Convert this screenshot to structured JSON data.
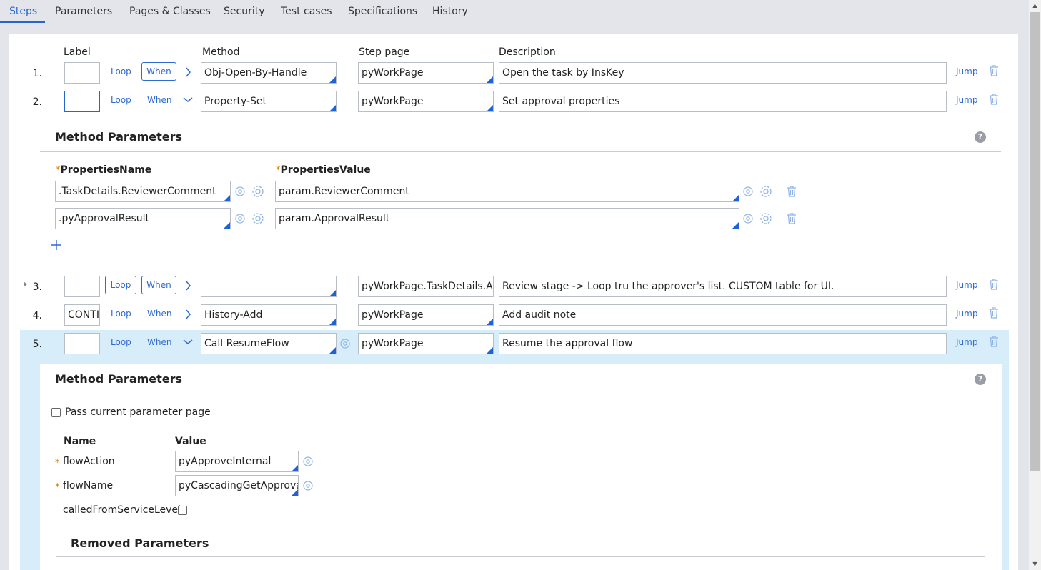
{
  "tabs": [
    "Steps",
    "Parameters",
    "Pages & Classes",
    "Security",
    "Test cases",
    "Specifications",
    "History"
  ],
  "columns": {
    "label": "Label",
    "method": "Method",
    "step_page": "Step page",
    "description": "Description"
  },
  "steps": [
    {
      "num": "1.",
      "label": "",
      "loop": "Loop",
      "when": "When",
      "method": "Obj-Open-By-Handle",
      "step_page": "pyWorkPage",
      "description": "Open the task by InsKey",
      "jump": "Jump"
    },
    {
      "num": "2.",
      "label": "",
      "loop": "Loop",
      "when": "When",
      "method": "Property-Set",
      "step_page": "pyWorkPage",
      "description": "Set approval properties",
      "jump": "Jump"
    },
    {
      "num": "3.",
      "label": "",
      "loop": "Loop",
      "when": "When",
      "method": "",
      "step_page": "pyWorkPage.TaskDetails.Ap",
      "description": "Review stage -> Loop tru the approver's list. CUSTOM table for UI.",
      "jump": "Jump"
    },
    {
      "num": "4.",
      "label": "CONTI",
      "loop": "Loop",
      "when": "When",
      "method": "History-Add",
      "step_page": "pyWorkPage",
      "description": "Add audit note",
      "jump": "Jump"
    },
    {
      "num": "5.",
      "label": "",
      "loop": "Loop",
      "when": "When",
      "method": "Call ResumeFlow",
      "step_page": "pyWorkPage",
      "description": "Resume the approval flow",
      "jump": "Jump"
    }
  ],
  "method_params_1": {
    "title": "Method Parameters",
    "help": "?",
    "name_header": "PropertiesName",
    "value_header": "PropertiesValue",
    "rows": [
      {
        "name": ".TaskDetails.ReviewerComment",
        "value": "param.ReviewerComment"
      },
      {
        "name": ".pyApprovalResult",
        "value": "param.ApprovalResult"
      }
    ]
  },
  "method_params_2": {
    "title": "Method Parameters",
    "help": "?",
    "pass_current": "Pass current parameter page",
    "name_header": "Name",
    "value_header": "Value",
    "rows": [
      {
        "name": "flowAction",
        "value": "pyApproveInternal",
        "required": true
      },
      {
        "name": "flowName",
        "value": "pyCascadingGetApproval",
        "required": true
      }
    ],
    "called_from": "calledFromServiceLevel",
    "removed": "Removed Parameters"
  },
  "colors": {
    "accent": "#2567cf",
    "highlight": "#d7edf9",
    "required": "#e07b00"
  }
}
